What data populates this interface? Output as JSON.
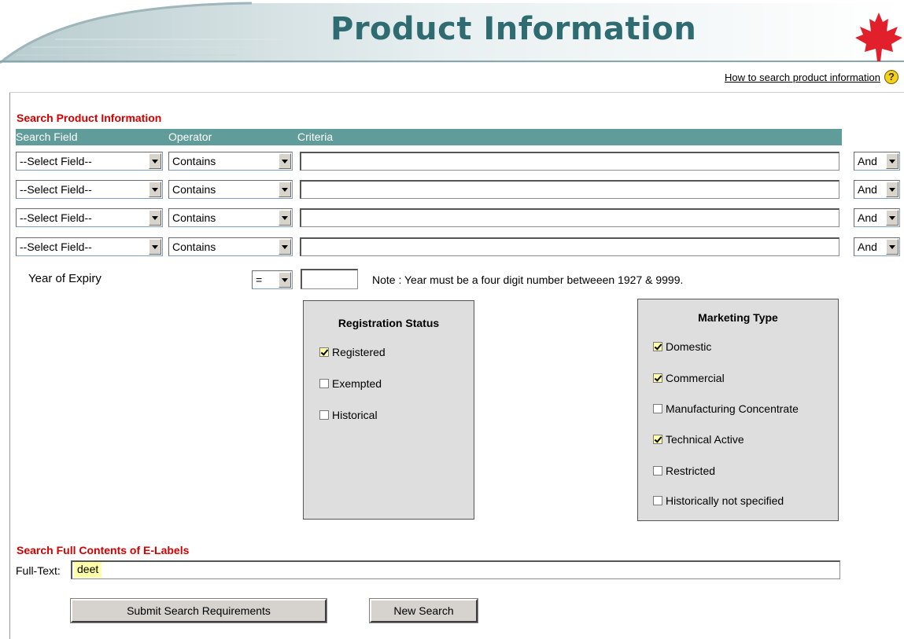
{
  "banner": {
    "title": "Product Information"
  },
  "help": {
    "link_label": "How to search product information",
    "icon_glyph": "?"
  },
  "search": {
    "title": "Search Product Information",
    "columns": {
      "field": "Search Field",
      "operator": "Operator",
      "criteria": "Criteria"
    },
    "rows": [
      {
        "field": "--Select Field--",
        "operator": "Contains",
        "criteria": "",
        "conjunction": "And"
      },
      {
        "field": "--Select Field--",
        "operator": "Contains",
        "criteria": "",
        "conjunction": "And"
      },
      {
        "field": "--Select Field--",
        "operator": "Contains",
        "criteria": "",
        "conjunction": "And"
      },
      {
        "field": "--Select Field--",
        "operator": "Contains",
        "criteria": "",
        "conjunction": "And"
      }
    ],
    "year": {
      "label": "Year of Expiry",
      "operator": "=",
      "value": "",
      "note": "Note : Year must be a four digit number betweeen 1927 & 9999."
    }
  },
  "registration_status": {
    "title": "Registration Status",
    "options": [
      {
        "label": "Registered",
        "checked": true
      },
      {
        "label": "Exempted",
        "checked": false
      },
      {
        "label": "Historical",
        "checked": false
      }
    ]
  },
  "marketing_type": {
    "title": "Marketing Type",
    "options": [
      {
        "label": "Domestic",
        "checked": true
      },
      {
        "label": "Commercial",
        "checked": true
      },
      {
        "label": "Manufacturing Concentrate",
        "checked": false
      },
      {
        "label": "Technical Active",
        "checked": true
      },
      {
        "label": "Restricted",
        "checked": false
      },
      {
        "label": "Historically not specified",
        "checked": false
      }
    ]
  },
  "fulltext": {
    "title": "Search Full Contents of E-Labels",
    "label": "Full-Text:",
    "value": "deet"
  },
  "buttons": {
    "submit": "Submit Search Requirements",
    "new_search": "New Search"
  },
  "colors": {
    "accent_red": "#d40000",
    "header_teal": "#5f9c9a",
    "title_teal": "#2e6c72",
    "highlight_yellow": "#ffffa8"
  }
}
